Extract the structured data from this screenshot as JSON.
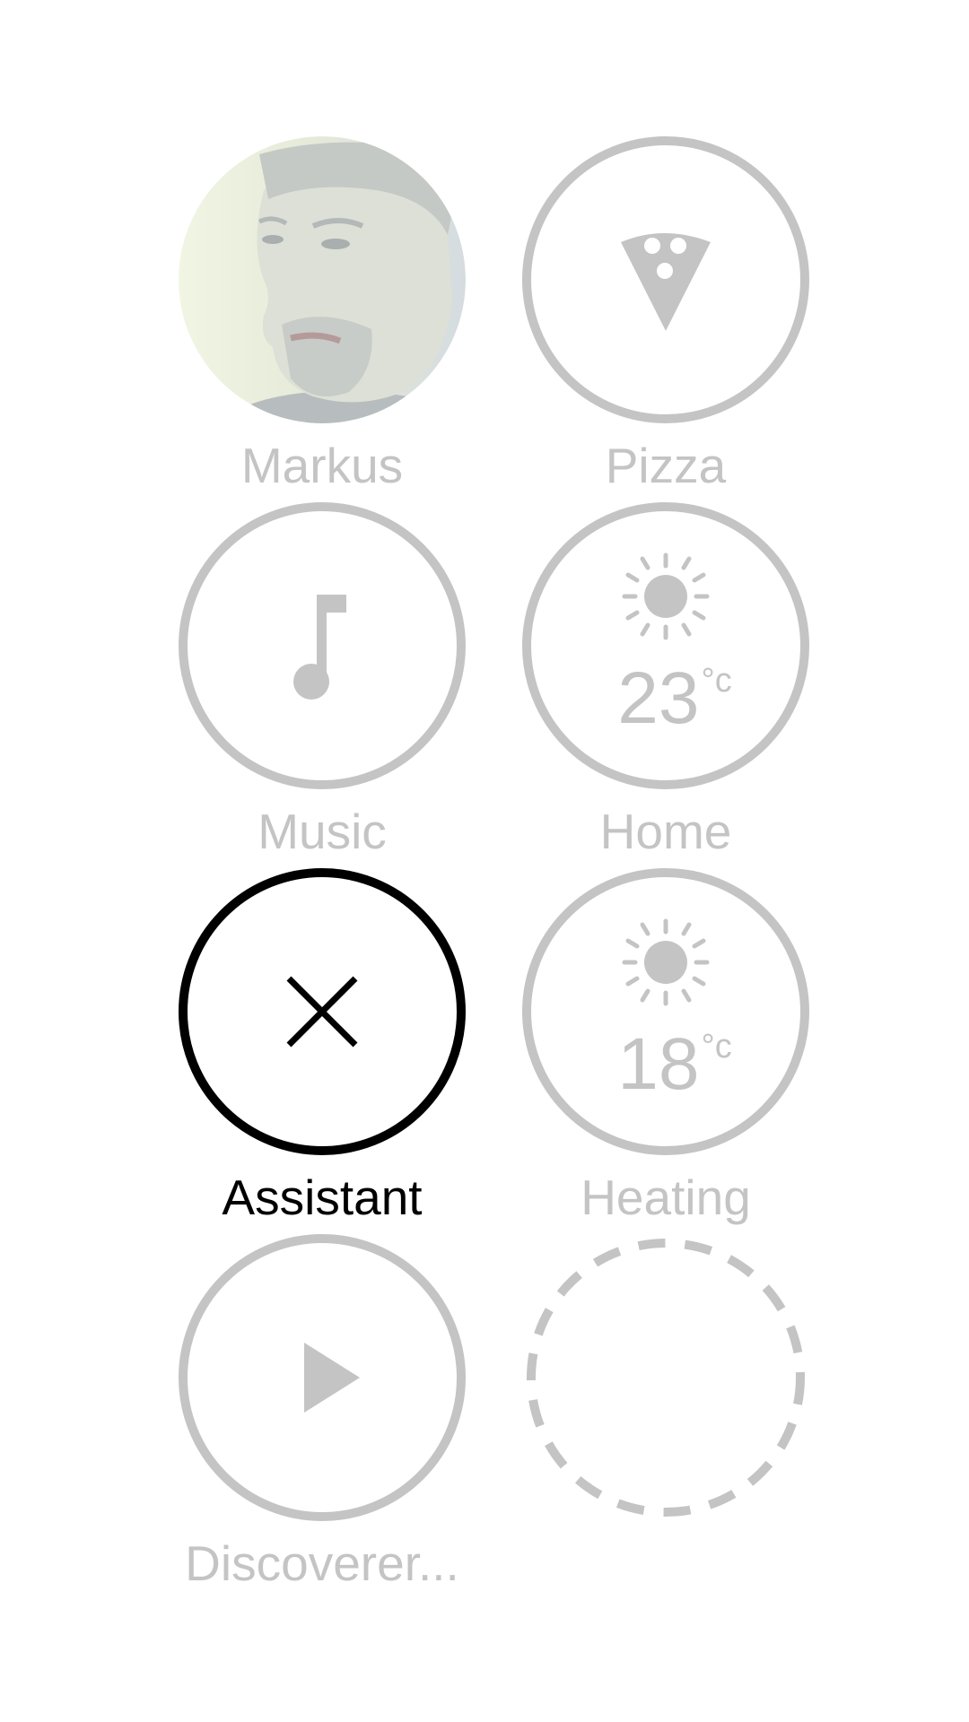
{
  "tiles": [
    {
      "label": "Markus",
      "icon": "avatar-photo"
    },
    {
      "label": "Pizza",
      "icon": "pizza-slice-icon"
    },
    {
      "label": "Music",
      "icon": "music-note-icon"
    },
    {
      "label": "Home",
      "icon": "sun-icon",
      "temperature": "23",
      "unit": "°c"
    },
    {
      "label": "Assistant",
      "icon": "close-icon",
      "active": true
    },
    {
      "label": "Heating",
      "icon": "sun-icon",
      "temperature": "18",
      "unit": "°c"
    },
    {
      "label": "Discoverer...",
      "icon": "play-icon"
    },
    {
      "label": "",
      "icon": "empty-slot"
    }
  ],
  "colors": {
    "inactive": "#c4c4c4",
    "active": "#000000",
    "background": "#ffffff"
  }
}
